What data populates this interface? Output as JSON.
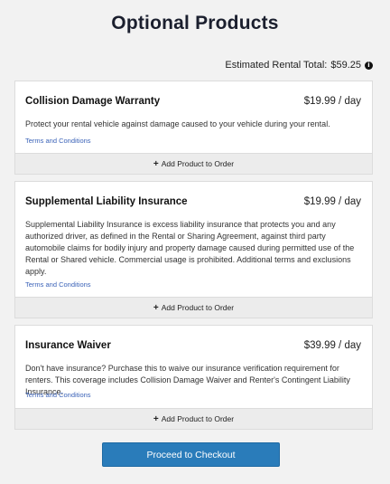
{
  "page": {
    "title": "Optional Products",
    "estimated_total_label": "Estimated Rental Total:",
    "estimated_total_value": "$59.25",
    "info_icon": "info-icon"
  },
  "products": [
    {
      "name": "Collision Damage Warranty",
      "price": "$19.99 / day",
      "description": "Protect your rental vehicle against damage caused to your vehicle during your rental.",
      "terms_link": "Terms and Conditions",
      "add_label": "Add Product to Order"
    },
    {
      "name": "Supplemental Liability Insurance",
      "price": "$19.99 / day",
      "description": "Supplemental Liability Insurance is excess liability insurance that protects you and any authorized driver, as defined in the Rental or Sharing Agreement, against third party automobile claims for bodily injury and property damage caused during permitted use of the Rental or Shared vehicle. Commercial usage is prohibited. Additional terms and exclusions apply.",
      "terms_link": "Terms and Conditions",
      "add_label": "Add Product to Order"
    },
    {
      "name": "Insurance Waiver",
      "price": "$39.99 / day",
      "description": "Don't have insurance? Purchase this to waive our insurance verification requirement for renters. This coverage includes Collision Damage Waiver and Renter's Contingent Liability Insurance.",
      "terms_link": "Terms and Conditions",
      "add_label": "Add Product to Order"
    }
  ],
  "checkout": {
    "label": "Proceed to Checkout"
  },
  "colors": {
    "link": "#3b63b8",
    "button": "#2a7cba",
    "add_bar": "#ececec"
  }
}
